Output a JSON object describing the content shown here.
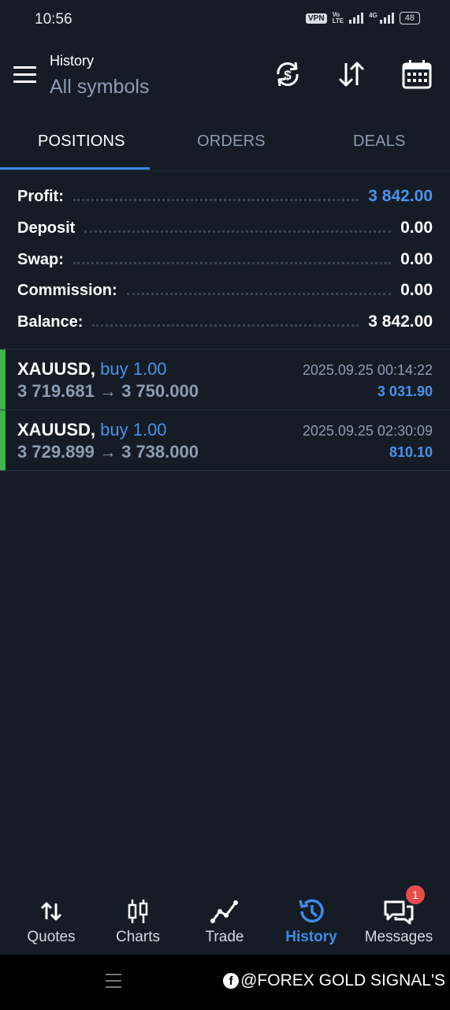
{
  "status": {
    "time": "10:56",
    "vpn": "VPN",
    "volte_top": "Vo",
    "volte_bottom": "LTE",
    "network": "4G",
    "battery": "48"
  },
  "header": {
    "title": "History",
    "subtitle": "All symbols",
    "icons": [
      "currency-refresh-icon",
      "sort-arrows-icon",
      "calendar-icon"
    ]
  },
  "tabs": [
    {
      "label": "POSITIONS",
      "active": true
    },
    {
      "label": "ORDERS",
      "active": false
    },
    {
      "label": "DEALS",
      "active": false
    }
  ],
  "summary": [
    {
      "label": "Profit:",
      "value": "3 842.00",
      "highlight": true
    },
    {
      "label": "Deposit",
      "value": "0.00",
      "highlight": false
    },
    {
      "label": "Swap:",
      "value": "0.00",
      "highlight": false
    },
    {
      "label": "Commission:",
      "value": "0.00",
      "highlight": false
    },
    {
      "label": "Balance:",
      "value": "3 842.00",
      "highlight": false
    }
  ],
  "positions": [
    {
      "symbol": "XAUUSD,",
      "side": "buy 1.00",
      "prices": "3 719.681 → 3 750.000",
      "time": "2025.09.25 00:14:22",
      "profit": "3 031.90"
    },
    {
      "symbol": "XAUUSD,",
      "side": "buy 1.00",
      "prices": "3 729.899 → 3 738.000",
      "time": "2025.09.25 02:30:09",
      "profit": "810.10"
    }
  ],
  "nav": [
    {
      "label": "Quotes",
      "icon": "quotes-icon",
      "active": false
    },
    {
      "label": "Charts",
      "icon": "candlestick-icon",
      "active": false
    },
    {
      "label": "Trade",
      "icon": "trade-line-icon",
      "active": false
    },
    {
      "label": "History",
      "icon": "history-clock-icon",
      "active": true
    },
    {
      "label": "Messages",
      "icon": "chat-icon",
      "active": false,
      "badge": "1"
    }
  ],
  "watermark": "@FOREX GOLD SIGNAL'S ",
  "colors": {
    "background": "#151c26",
    "accent": "#3d8be6",
    "buy_bar": "#3fb44a",
    "badge": "#e84c4c"
  }
}
